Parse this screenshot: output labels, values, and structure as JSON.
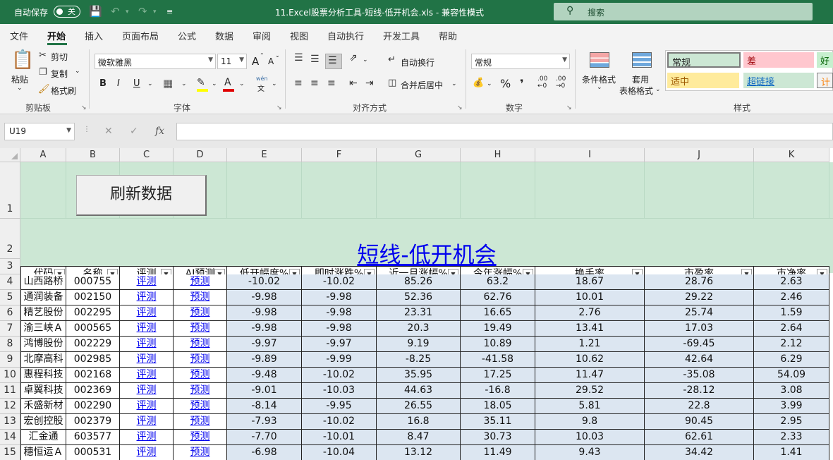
{
  "titlebar": {
    "autosave_label": "自动保存",
    "autosave_state": "关",
    "document_title": "11.Excel股票分析工具-短线-低开机会.xls  -  兼容性模式",
    "search_placeholder": "搜索"
  },
  "ribbon_tabs": [
    "文件",
    "开始",
    "插入",
    "页面布局",
    "公式",
    "数据",
    "审阅",
    "视图",
    "自动执行",
    "开发工具",
    "帮助"
  ],
  "active_tab": "开始",
  "clipboard": {
    "paste": "粘贴",
    "cut": "剪切",
    "copy": "复制",
    "format_painter": "格式刷",
    "group": "剪贴板"
  },
  "font": {
    "name": "微软雅黑",
    "size": "11",
    "group": "字体",
    "bold": "B",
    "italic": "I",
    "underline": "U",
    "grow": "A",
    "shrink": "A",
    "phonetic_top": "wén",
    "phonetic_bottom": "文"
  },
  "alignment": {
    "wrap": "自动换行",
    "merge": "合并后居中",
    "group": "对齐方式"
  },
  "number": {
    "format": "常规",
    "group": "数字",
    "percent": "%",
    "comma": "❜",
    "inc_decimal": ".00",
    "dec_decimal": ".00"
  },
  "styles": {
    "conditional": "条件格式",
    "table_line1": "套用",
    "table_line2": "表格格式",
    "normal": "常规",
    "bad": "差",
    "good": "好",
    "neutral": "适中",
    "hyperlink": "超链接",
    "calc": "计",
    "group": "样式",
    "colors": {
      "normal": "#cce7d4",
      "bad": "#ffc7ce",
      "good": "#c6efce",
      "neutral": "#ffeb9c",
      "hyperlink": "#cce7d4"
    }
  },
  "formula_bar": {
    "name_box": "U19",
    "cancel": "✕",
    "enter": "✓",
    "fx": "fx",
    "formula": ""
  },
  "columns": [
    "A",
    "B",
    "C",
    "D",
    "E",
    "F",
    "G",
    "H",
    "I",
    "J",
    "K"
  ],
  "row_numbers": [
    "1",
    "2",
    "3",
    "4",
    "5",
    "6",
    "7",
    "8",
    "9",
    "10",
    "11",
    "12",
    "13",
    "14",
    "15"
  ],
  "sheet": {
    "refresh_button": "刷新数据",
    "title": "短线-低开机会",
    "headers": [
      "代码",
      "名称",
      "评测",
      "AI预测",
      "低开幅度%",
      "即时涨跌%",
      "近一月涨幅%",
      "今年涨幅%",
      "换手率",
      "市盈率",
      "市净率"
    ],
    "rows": [
      [
        "山西路桥",
        "000755",
        "评测",
        "预测",
        "-10.02",
        "-10.02",
        "85.26",
        "63.2",
        "18.67",
        "28.76",
        "2.63"
      ],
      [
        "通润装备",
        "002150",
        "评测",
        "预测",
        "-9.98",
        "-9.98",
        "52.36",
        "62.76",
        "10.01",
        "29.22",
        "2.46"
      ],
      [
        "精艺股份",
        "002295",
        "评测",
        "预测",
        "-9.98",
        "-9.98",
        "23.31",
        "16.65",
        "2.76",
        "25.74",
        "1.59"
      ],
      [
        "渝三峡Ａ",
        "000565",
        "评测",
        "预测",
        "-9.98",
        "-9.98",
        "20.3",
        "19.49",
        "13.41",
        "17.03",
        "2.64"
      ],
      [
        "鸿博股份",
        "002229",
        "评测",
        "预测",
        "-9.97",
        "-9.97",
        "9.19",
        "10.89",
        "1.21",
        "-69.45",
        "2.12"
      ],
      [
        "北摩高科",
        "002985",
        "评测",
        "预测",
        "-9.89",
        "-9.99",
        "-8.25",
        "-41.58",
        "10.62",
        "42.64",
        "6.29"
      ],
      [
        "惠程科技",
        "002168",
        "评测",
        "预测",
        "-9.48",
        "-10.02",
        "35.95",
        "17.25",
        "11.47",
        "-35.08",
        "54.09"
      ],
      [
        "卓翼科技",
        "002369",
        "评测",
        "预测",
        "-9.01",
        "-10.03",
        "44.63",
        "-16.8",
        "29.52",
        "-28.12",
        "3.08"
      ],
      [
        "禾盛新材",
        "002290",
        "评测",
        "预测",
        "-8.14",
        "-9.95",
        "26.55",
        "18.05",
        "5.81",
        "22.8",
        "3.99"
      ],
      [
        "宏创控股",
        "002379",
        "评测",
        "预测",
        "-7.93",
        "-10.02",
        "16.8",
        "35.11",
        "9.8",
        "90.45",
        "2.95"
      ],
      [
        "汇金通",
        "603577",
        "评测",
        "预测",
        "-7.70",
        "-10.01",
        "8.47",
        "30.73",
        "10.03",
        "62.61",
        "2.33"
      ],
      [
        "穗恒运Ａ",
        "000531",
        "评测",
        "预测",
        "-6.98",
        "-10.04",
        "13.12",
        "11.49",
        "9.43",
        "34.42",
        "1.41"
      ]
    ]
  }
}
